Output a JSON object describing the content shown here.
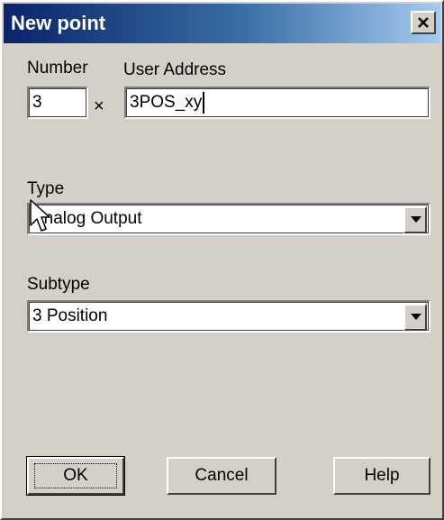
{
  "window": {
    "title": "New point"
  },
  "number": {
    "label": "Number",
    "value": "3"
  },
  "separator": "×",
  "address": {
    "label": "User Address",
    "value": "3POS_xy"
  },
  "type": {
    "label": "Type",
    "selected": "Analog Output"
  },
  "subtype": {
    "label": "Subtype",
    "selected": "3 Position"
  },
  "buttons": {
    "ok": "OK",
    "cancel": "Cancel",
    "help": "Help"
  },
  "colors": {
    "title_start": "#0a246a",
    "title_end": "#a6caf0",
    "face": "#d4d0c8"
  },
  "icons": {
    "close": "close-icon",
    "dropdown": "chevron-down-icon",
    "cursor": "mouse-pointer-icon"
  }
}
